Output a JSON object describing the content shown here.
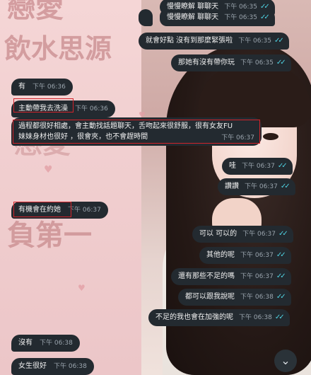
{
  "background": {
    "chars_top": "戀愛",
    "chars_line2": "飲水思源",
    "chars_mid": "戀愛",
    "chars_bottom": "負第一"
  },
  "messages": [
    {
      "dir": "out",
      "text": "慢慢瞭解 聊聊天",
      "time": "下午 06:35"
    },
    {
      "dir": "out",
      "text": "就會好點 沒有到那麼緊張啦",
      "time": "下午 06:35"
    },
    {
      "dir": "out",
      "text": "那她有沒有帶你玩",
      "time": "下午 06:35"
    },
    {
      "dir": "in",
      "text": "有",
      "time": "下午 06:36"
    },
    {
      "dir": "in",
      "text": "主動帶我去洗澡",
      "time": "下午 06:36"
    },
    {
      "dir": "in",
      "text_line1": "過程都很好相處，會主動找話題聊天，舌吻起來很舒服，很有女友FU",
      "text_line2": "妹妹身材也很好 ，很會夾，也不會趕時間",
      "time": "下午 06:37"
    },
    {
      "dir": "out",
      "text": "哇",
      "time": "下午 06:37"
    },
    {
      "dir": "out",
      "text": "讚讚",
      "time": "下午 06:37"
    },
    {
      "dir": "in",
      "text": "有機會在約她",
      "time": "下午 06:37"
    },
    {
      "dir": "out",
      "text": "可以 可以的",
      "time": "下午 06:37"
    },
    {
      "dir": "out",
      "text": "其他的呢",
      "time": "下午 06:37"
    },
    {
      "dir": "out",
      "text": "還有那些不足的嗎",
      "time": "下午 06:37"
    },
    {
      "dir": "out",
      "text": "都可以跟我說呢",
      "time": "下午 06:38"
    },
    {
      "dir": "out",
      "text": "不足的我也會在加強的呢",
      "time": "下午 06:38"
    },
    {
      "dir": "in",
      "text": "沒有",
      "time": "下午 06:38"
    },
    {
      "dir": "in",
      "text": "女生很好",
      "time": "下午 06:38"
    }
  ],
  "check_glyph": "✓✓",
  "scroll_glyph": "⌄"
}
